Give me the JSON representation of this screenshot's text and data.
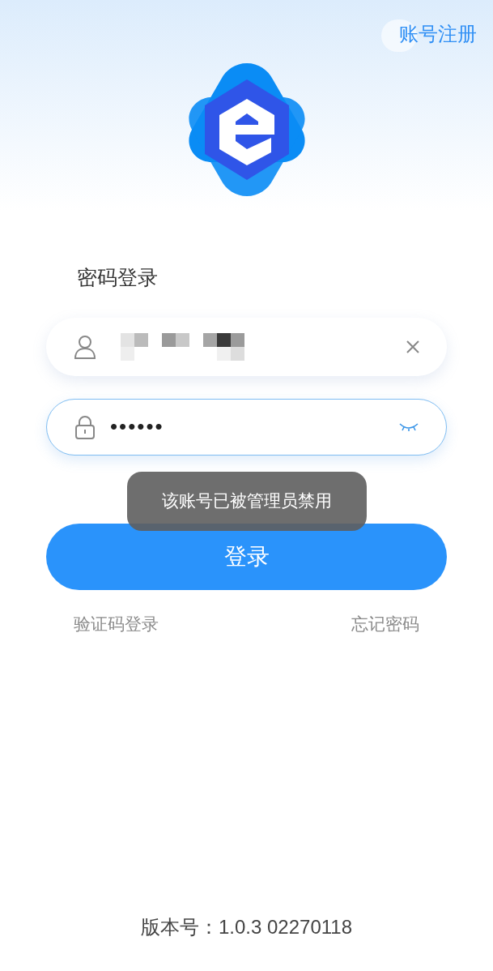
{
  "header": {
    "register_link": "账号注册"
  },
  "login": {
    "title": "密码登录",
    "username": {
      "redacted": true,
      "clearable": true
    },
    "password": {
      "value": "••••••",
      "masked": true,
      "focused": true
    },
    "toast": "该账号已被管理员禁用",
    "submit": "登录",
    "links": [
      "验证码登录",
      "忘记密码"
    ]
  },
  "footer": {
    "version": "版本号：1.0.3 02270118"
  }
}
